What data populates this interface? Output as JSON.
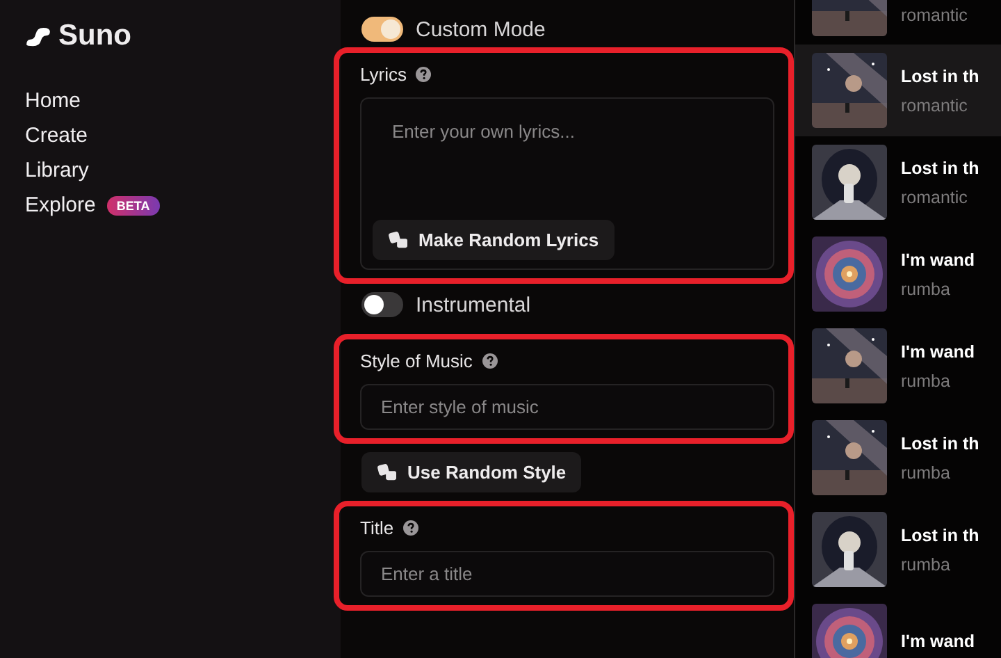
{
  "sidebar": {
    "logo": "Suno",
    "items": [
      {
        "label": "Home"
      },
      {
        "label": "Create"
      },
      {
        "label": "Library"
      },
      {
        "label": "Explore",
        "badge": "BETA"
      }
    ]
  },
  "form": {
    "custom_mode": {
      "label": "Custom Mode",
      "on": true
    },
    "lyrics": {
      "label": "Lyrics",
      "highlighted": true,
      "placeholder": "Enter your own lyrics...",
      "button": "Make Random Lyrics"
    },
    "instrumental": {
      "label": "Instrumental",
      "on": false
    },
    "style": {
      "label": "Style of Music",
      "highlighted": true,
      "placeholder": "Enter style of music",
      "button": "Use Random Style"
    },
    "title": {
      "label": "Title",
      "highlighted": true,
      "placeholder": "Enter a title"
    }
  },
  "songs": [
    {
      "style": "romantic",
      "selected": false
    },
    {
      "title": "Lost in th",
      "style": "romantic",
      "selected": true
    },
    {
      "title": "Lost in th",
      "style": "romantic",
      "selected": false
    },
    {
      "title": "I'm wand",
      "style": "rumba",
      "selected": false
    },
    {
      "title": "I'm wand",
      "style": "rumba",
      "selected": false
    },
    {
      "title": "Lost in th",
      "style": "rumba",
      "selected": false
    },
    {
      "title": "Lost in th",
      "style": "rumba",
      "selected": false
    },
    {
      "title": "I'm wand",
      "selected": false
    }
  ]
}
